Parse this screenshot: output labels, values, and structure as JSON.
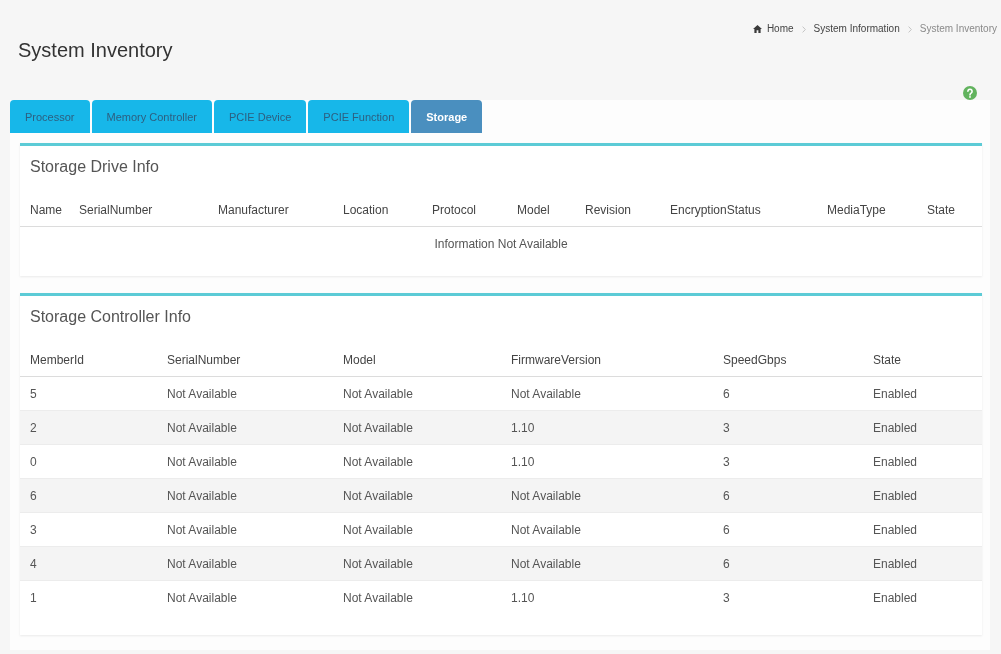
{
  "page": {
    "title": "System Inventory"
  },
  "breadcrumb": [
    {
      "kind": "home",
      "label": "Home",
      "current": false
    },
    {
      "kind": "link",
      "label": "System Information",
      "current": false
    },
    {
      "kind": "link",
      "label": "System Inventory",
      "current": true
    }
  ],
  "tabs": [
    {
      "label": "Processor",
      "selected": false
    },
    {
      "label": "Memory Controller",
      "selected": false
    },
    {
      "label": "PCIE Device",
      "selected": false
    },
    {
      "label": "PCIE Function",
      "selected": false
    },
    {
      "label": "Storage",
      "selected": true
    }
  ],
  "drive_info": {
    "title": "Storage Drive Info",
    "columns": [
      "Name",
      "SerialNumber",
      "Manufacturer",
      "Location",
      "Protocol",
      "Model",
      "Revision",
      "EncryptionStatus",
      "MediaType",
      "State"
    ],
    "empty_message": "Information Not Available"
  },
  "controller_info": {
    "title": "Storage Controller Info",
    "columns": [
      "MemberId",
      "SerialNumber",
      "Model",
      "FirmwareVersion",
      "SpeedGbps",
      "State"
    ],
    "rows": [
      [
        "5",
        "Not Available",
        "Not Available",
        "Not Available",
        "6",
        "Enabled"
      ],
      [
        "2",
        "Not Available",
        "Not Available",
        "1.10",
        "3",
        "Enabled"
      ],
      [
        "0",
        "Not Available",
        "Not Available",
        "1.10",
        "3",
        "Enabled"
      ],
      [
        "6",
        "Not Available",
        "Not Available",
        "Not Available",
        "6",
        "Enabled"
      ],
      [
        "3",
        "Not Available",
        "Not Available",
        "Not Available",
        "6",
        "Enabled"
      ],
      [
        "4",
        "Not Available",
        "Not Available",
        "Not Available",
        "6",
        "Enabled"
      ],
      [
        "1",
        "Not Available",
        "Not Available",
        "1.10",
        "3",
        "Enabled"
      ]
    ]
  }
}
